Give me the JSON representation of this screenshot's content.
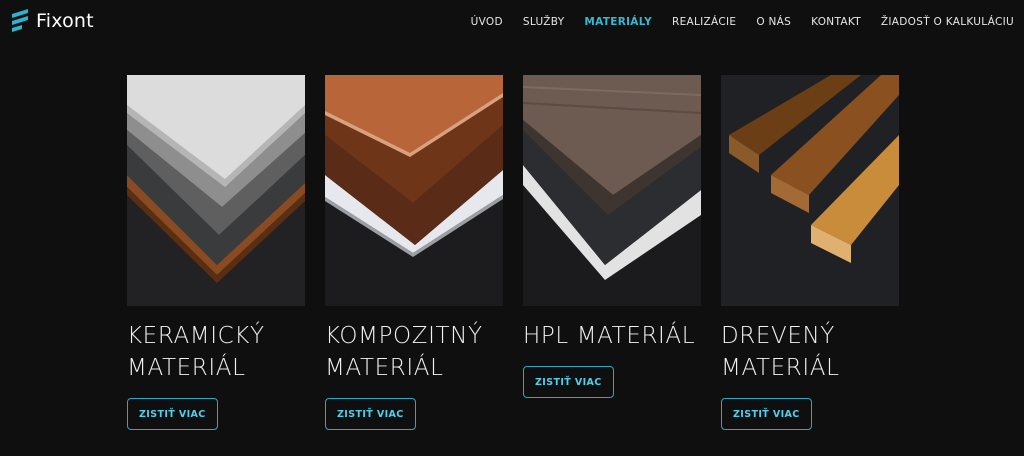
{
  "header": {
    "brand": "Fixont",
    "accent": "#36b7d3",
    "nav": [
      {
        "label": "ÚVOD",
        "active": false
      },
      {
        "label": "SLUŽBY",
        "active": false
      },
      {
        "label": "MATERIÁLY",
        "active": true
      },
      {
        "label": "REALIZÁCIE",
        "active": false
      },
      {
        "label": "O NÁS",
        "active": false
      },
      {
        "label": "KONTAKT",
        "active": false
      },
      {
        "label": "ŽIADOSŤ O KALKULÁCIU",
        "active": false
      }
    ]
  },
  "materials": [
    {
      "title_line1": "KERAMICKÝ",
      "title_line2": "MATERIÁL",
      "button": "ZISTIŤ VIAC"
    },
    {
      "title_line1": "KOMPOZITNÝ",
      "title_line2": "MATERIÁL",
      "button": "ZISTIŤ VIAC"
    },
    {
      "title_line1": "HPL MATERIÁL",
      "title_line2": "",
      "button": "ZISTIŤ VIAC"
    },
    {
      "title_line1": "DREVENÝ",
      "title_line2": "MATERIÁL",
      "button": "ZISTIŤ VIAC"
    }
  ]
}
